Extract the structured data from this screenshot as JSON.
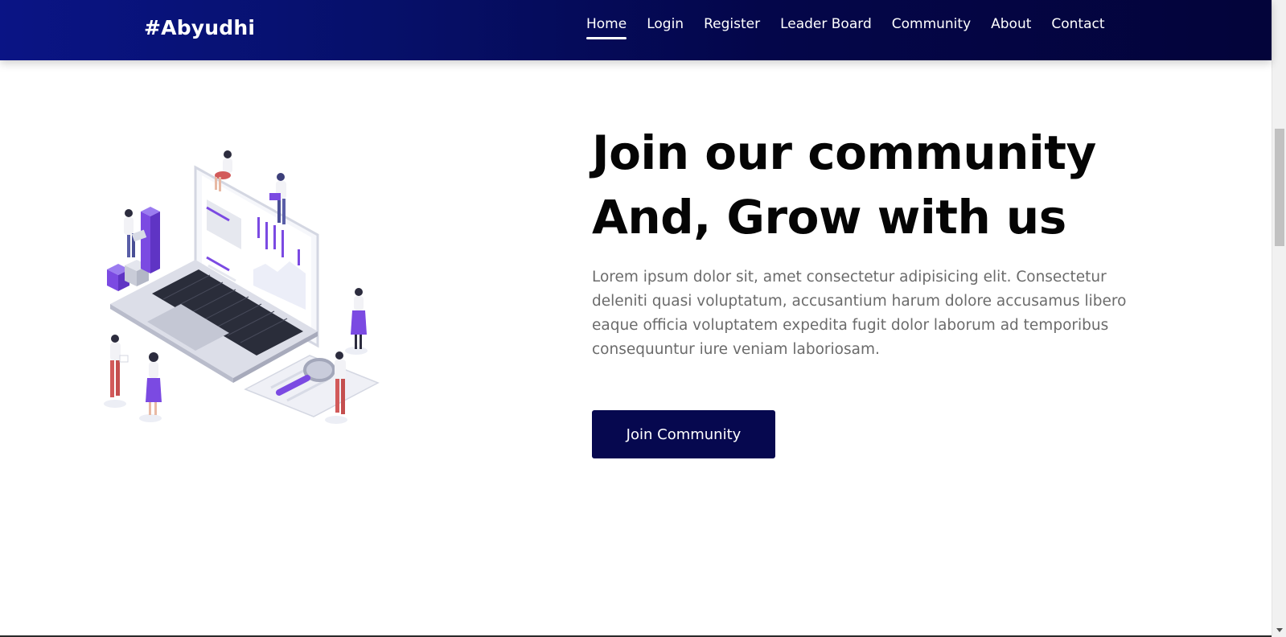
{
  "navbar": {
    "brand": "#Abyudhi",
    "links": [
      {
        "label": "Home",
        "active": true
      },
      {
        "label": "Login"
      },
      {
        "label": "Register"
      },
      {
        "label": "Leader Board"
      },
      {
        "label": "Community"
      },
      {
        "label": "About"
      },
      {
        "label": "Contact"
      }
    ]
  },
  "hero": {
    "title_line1": "Join our community",
    "title_line2": "And, Grow with us",
    "description": "Lorem ipsum dolor sit, amet consectetur adipisicing elit. Consectetur deleniti quasi voluptatum, accusantium harum dolore accusamus libero eaque officia voluptatem expedita fugit dolor laborum ad temporibus consequuntur iure veniam laboriosam.",
    "button_label": "Join Community"
  },
  "illustration": {
    "icon": "isometric-laptop-team-illustration"
  },
  "colors": {
    "nav_start": "#0a1485",
    "nav_end": "#03043a",
    "button": "#06084f",
    "accent_purple": "#7b4ae2",
    "accent_red": "#d25a5a"
  }
}
